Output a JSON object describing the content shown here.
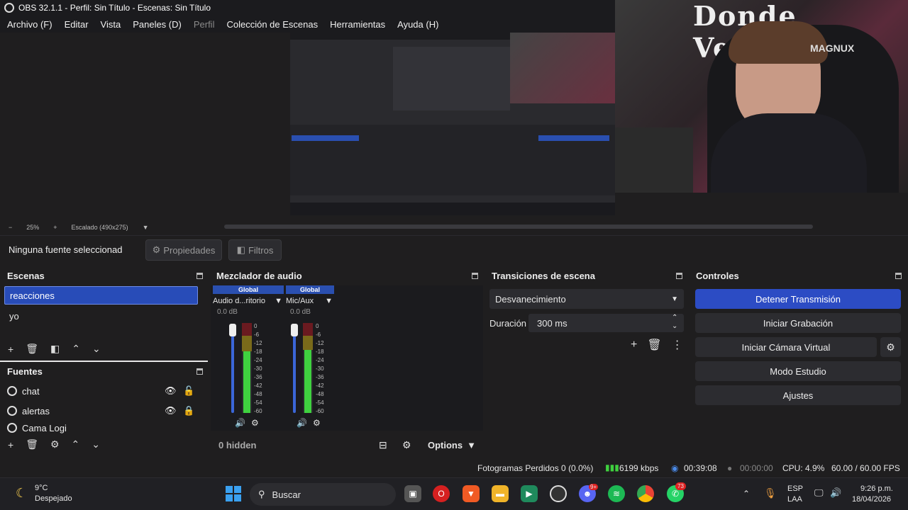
{
  "window": {
    "title": "OBS 32.1.1 - Perfil: Sin Título - Escenas: Sin Título"
  },
  "menu": [
    "Archivo (F)",
    "Editar",
    "Vista",
    "Paneles (D)",
    "Perfil",
    "Colección de Escenas",
    "Herramientas",
    "Ayuda (H)"
  ],
  "preview": {
    "zoom": "25%",
    "scale_label": "Escalado (490x275)",
    "cam_text": "Donde Ventas",
    "chair_brand": "MAGNUX"
  },
  "context_bar": {
    "no_source": "Ninguna fuente seleccionad",
    "properties": "Propiedades",
    "filters": "Filtros"
  },
  "scenes": {
    "title": "Escenas",
    "items": [
      "reacciones",
      "yo"
    ],
    "selected": "reacciones"
  },
  "sources": {
    "title": "Fuentes",
    "items": [
      "chat",
      "alertas",
      "Cama Logi"
    ]
  },
  "mixer": {
    "title": "Mezclador de audio",
    "channels": [
      {
        "scope": "Global",
        "name": "Audio d...ritorio",
        "db": "0.0 dB",
        "level": 0.8
      },
      {
        "scope": "Global",
        "name": "Mic/Aux",
        "db": "0.0 dB",
        "level": 0.6
      }
    ],
    "scale": [
      "0",
      "-6",
      "-12",
      "-18",
      "-24",
      "-30",
      "-36",
      "-42",
      "-48",
      "-54",
      "-60"
    ],
    "hidden": "0 hidden",
    "options": "Options"
  },
  "transitions": {
    "title": "Transiciones de escena",
    "selected": "Desvanecimiento",
    "duration_label": "Duración",
    "duration_value": "300 ms"
  },
  "controls": {
    "title": "Controles",
    "buttons": [
      "Detener Transmisión",
      "Iniciar Grabación",
      "Iniciar Cámara Virtual",
      "Modo Estudio",
      "Ajustes"
    ]
  },
  "status": {
    "dropped": "Fotogramas Perdidos 0 (0.0%)",
    "bitrate": "6199 kbps",
    "stream_time": "00:39:08",
    "rec_time": "00:00:00",
    "cpu": "CPU: 4.9%",
    "fps": "60.00 / 60.00 FPS"
  },
  "taskbar": {
    "weather_temp": "9°C",
    "weather_desc": "Despejado",
    "search": "Buscar",
    "lang1": "ESP",
    "lang2": "LAA",
    "time": "9:26 p.m.",
    "date": "18/04/2026",
    "discord_badge": "9+",
    "whatsapp_badge": "73"
  },
  "colors": {
    "accent": "#284cb8",
    "panel": "#1f1e1f",
    "meter_green": "#3fd13f",
    "meter_yellow": "#c9c31b",
    "meter_red": "#c4202b"
  }
}
